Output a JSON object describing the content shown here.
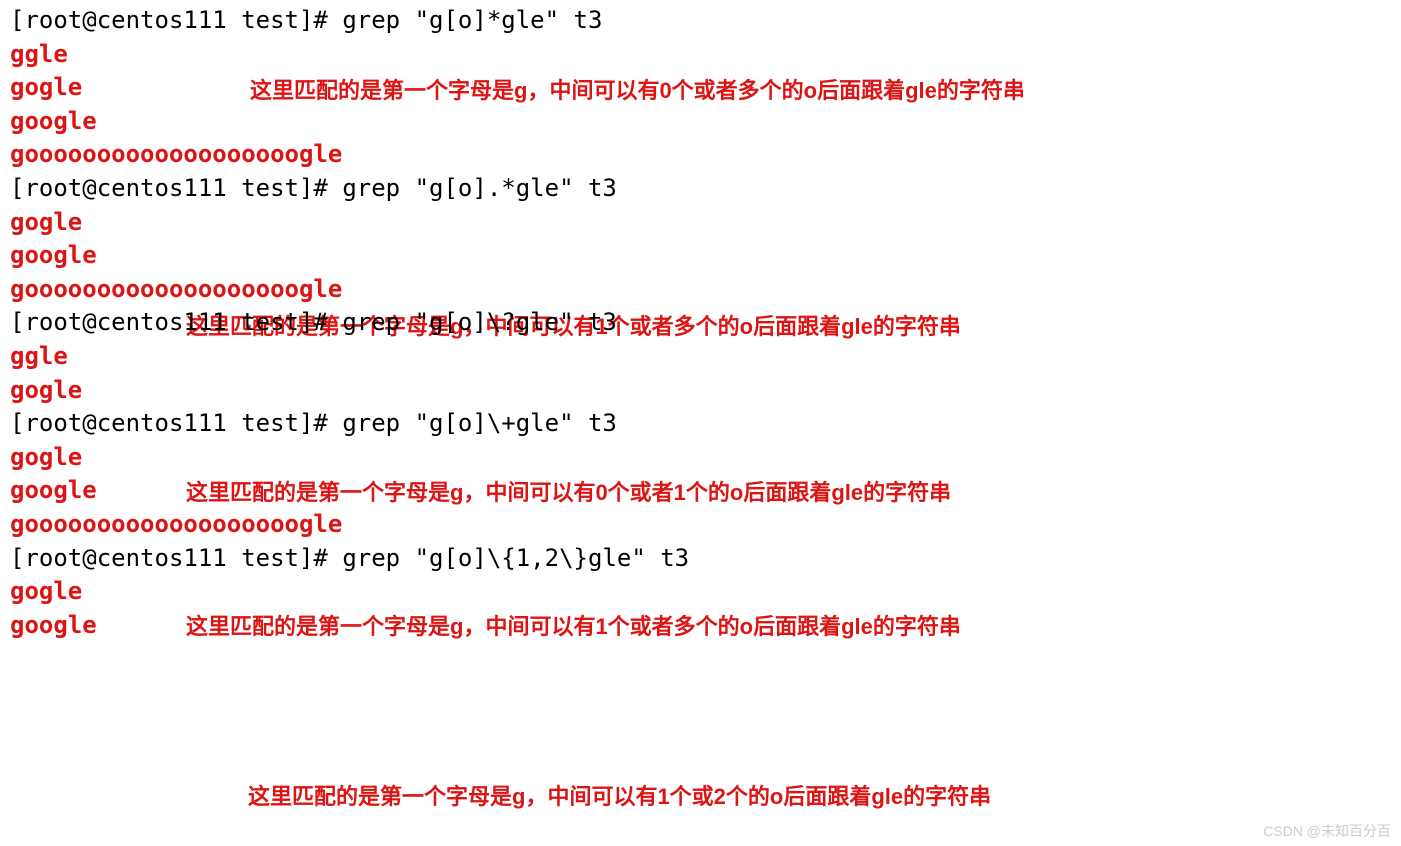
{
  "terminal": {
    "blocks": [
      {
        "prompt": "[root@centos111 test]# grep \"g[o]*gle\" t3",
        "matches": [
          "ggle",
          "gogle",
          "google",
          "gooooooooooooooooooogle"
        ],
        "annotation": "这里匹配的是第一个字母是g，中间可以有0个或者多个的o后面跟着gle的字符串"
      },
      {
        "prompt": "[root@centos111 test]# grep \"g[o].*gle\" t3",
        "matches": [
          "gogle",
          "google",
          "gooooooooooooooooooogle"
        ],
        "annotation": "这里匹配的是第一个字母是g，中间可以有1个或者多个的o后面跟着gle的字符串"
      },
      {
        "prompt": "[root@centos111 test]# grep \"g[o]\\?gle\" t3",
        "matches": [
          "ggle",
          "gogle"
        ],
        "annotation": "这里匹配的是第一个字母是g，中间可以有0个或者1个的o后面跟着gle的字符串"
      },
      {
        "prompt": "[root@centos111 test]# grep \"g[o]\\+gle\" t3",
        "matches": [
          "gogle",
          "google",
          "gooooooooooooooooooogle"
        ],
        "annotation": "这里匹配的是第一个字母是g，中间可以有1个或者多个的o后面跟着gle的字符串"
      },
      {
        "prompt": "[root@centos111 test]# grep \"g[o]\\{1,2\\}gle\" t3",
        "matches": [
          "gogle",
          "google"
        ],
        "annotation": "这里匹配的是第一个字母是g，中间可以有1个或2个的o后面跟着gle的字符串"
      }
    ]
  },
  "watermark": "CSDN @未知百分百"
}
